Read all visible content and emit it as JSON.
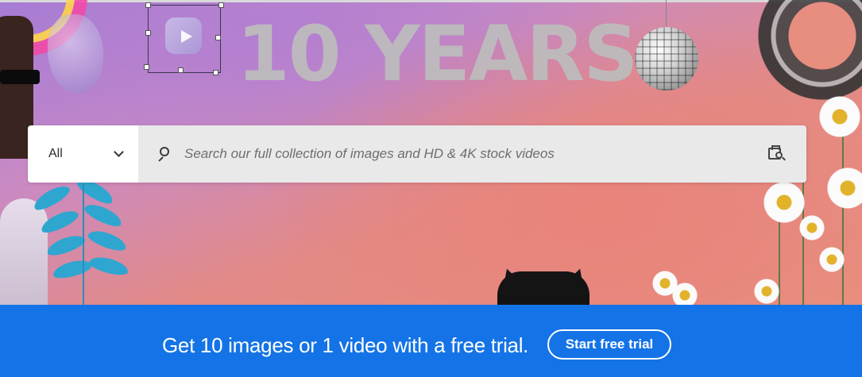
{
  "hero": {
    "title": "10 YEARS"
  },
  "search": {
    "category_value": "All",
    "placeholder": "Search our full collection of images and HD & 4K stock videos",
    "query": ""
  },
  "icons": {
    "category": "chevron-down-icon",
    "search": "search-icon",
    "visual_search": "visual-search-icon"
  },
  "promo": {
    "text": "Get 10 images or 1 video with a free trial.",
    "button_label": "Start free trial"
  },
  "colors": {
    "promo_background": "#1473e6",
    "search_field": "#e9e9e9",
    "hero_title": "#bdbdbd"
  }
}
